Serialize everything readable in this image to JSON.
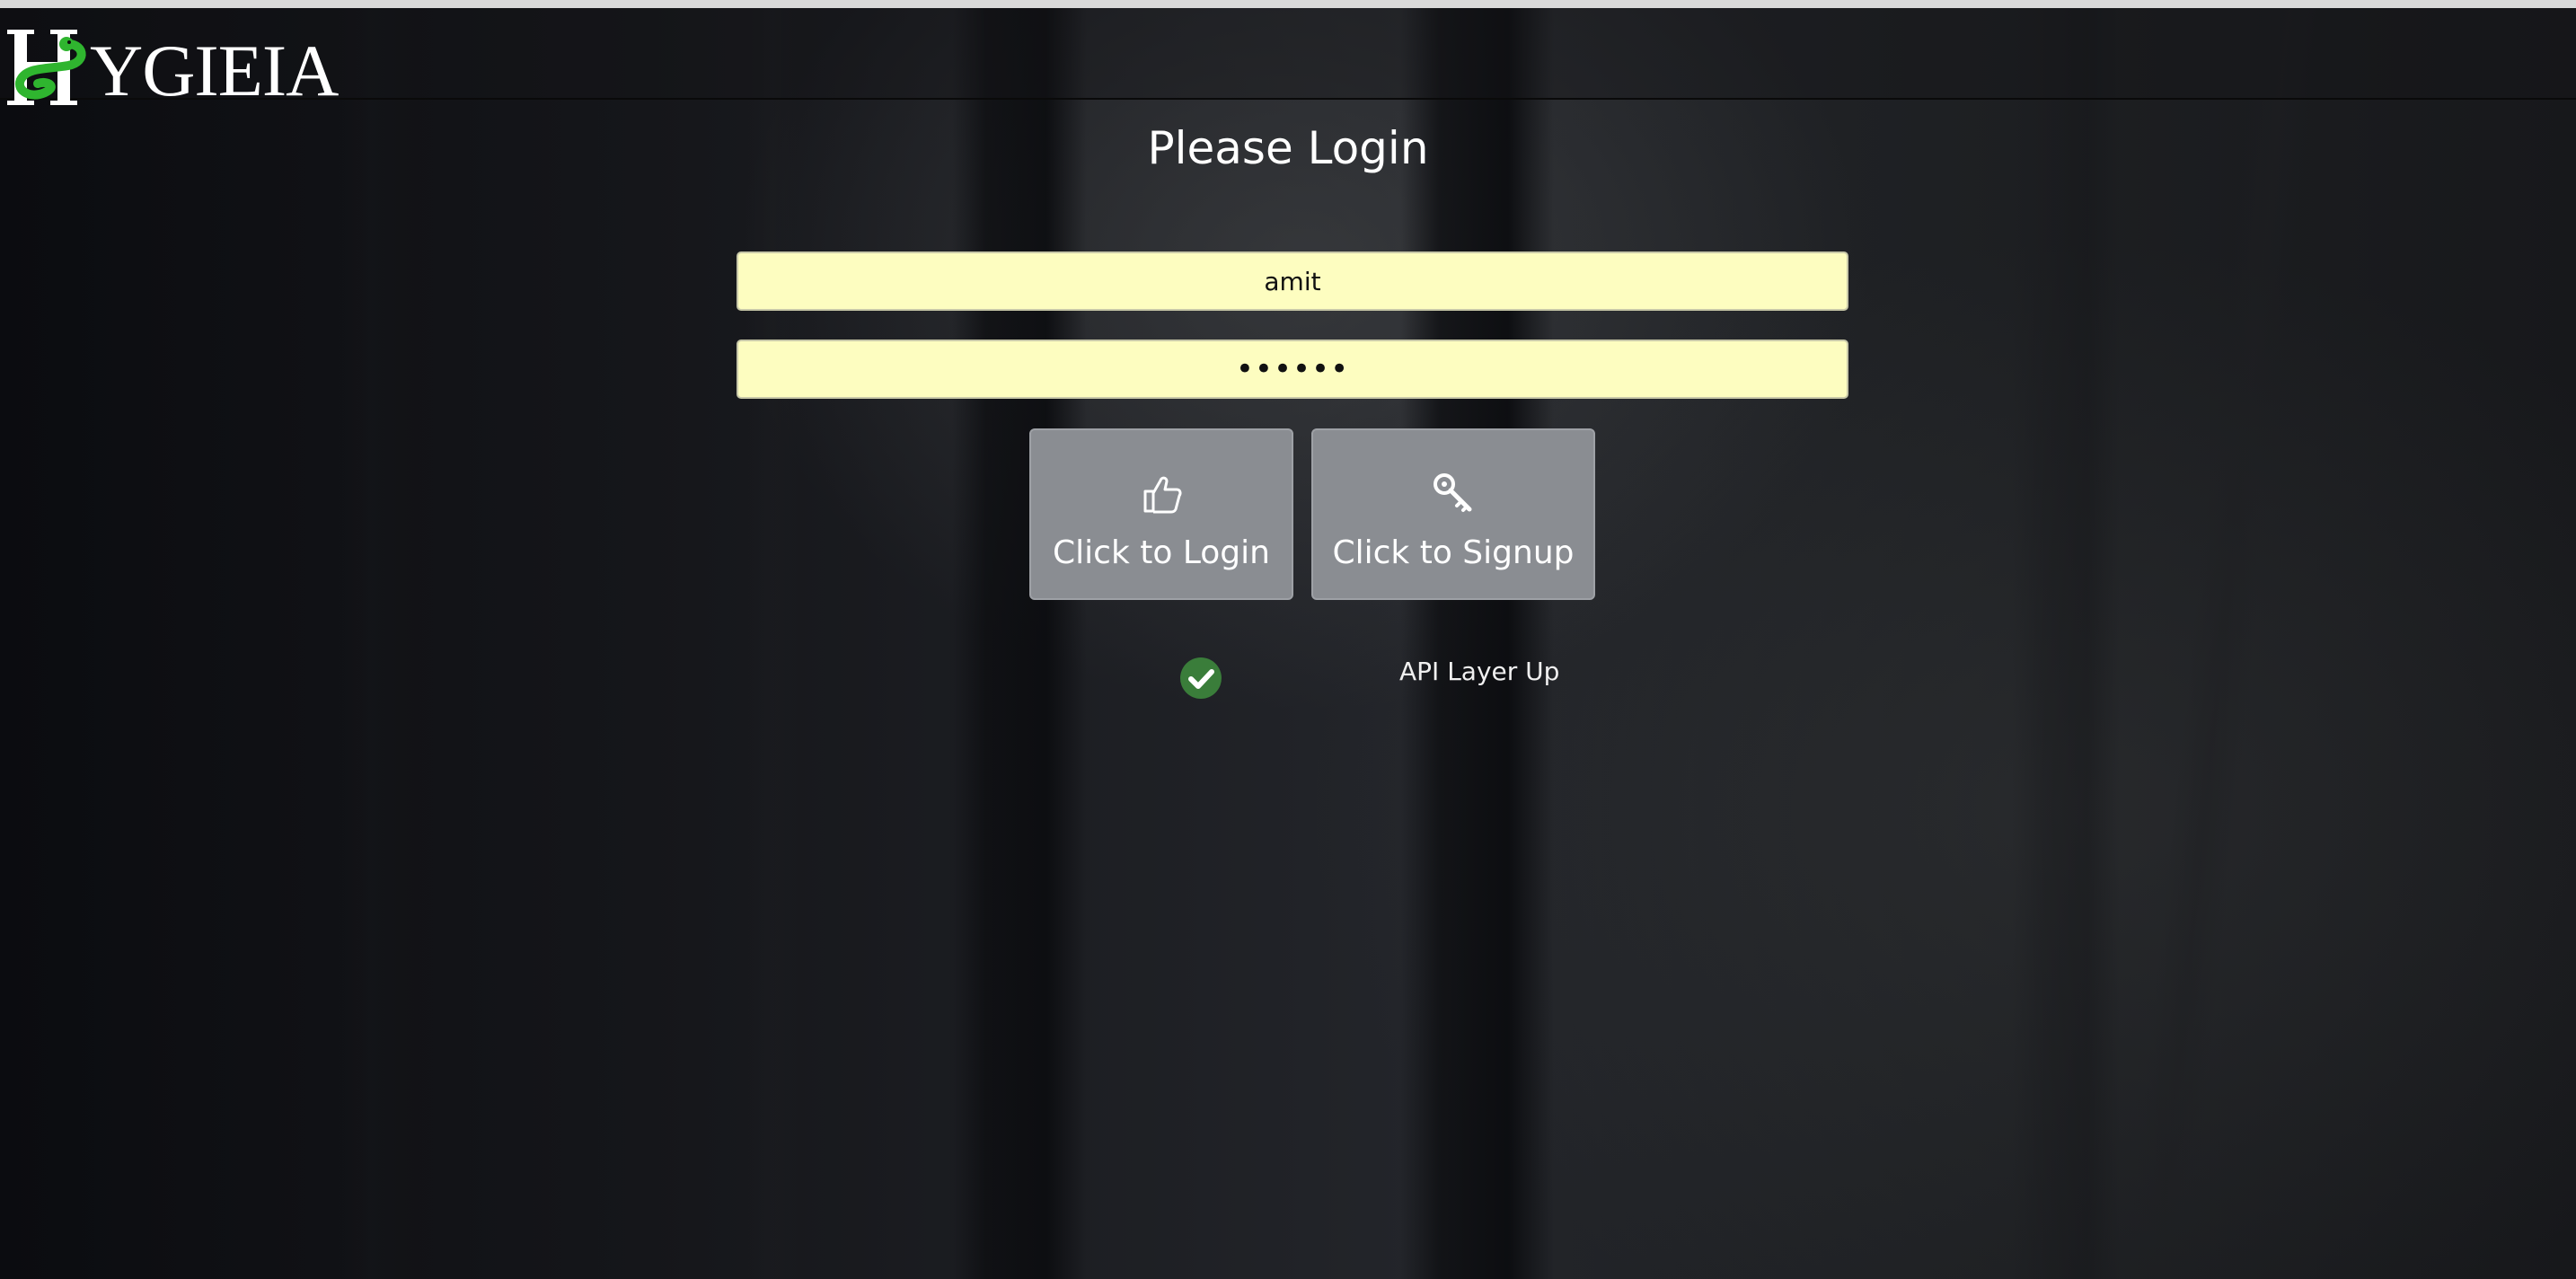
{
  "app": {
    "logo_text": "YGIEIA",
    "logo_initial": "H"
  },
  "login": {
    "title": "Please Login",
    "username_value": "amit",
    "password_value": "••••••",
    "login_button_label": "Click to Login",
    "signup_button_label": "Click to Signup"
  },
  "status": {
    "text": "API Layer Up",
    "icon": "check-circle-icon",
    "color": "#3a7d3a"
  },
  "icons": {
    "login": "thumbs-up-icon",
    "signup": "key-icon",
    "logo": "snake-icon"
  },
  "colors": {
    "input_background": "#fdfdc0",
    "button_background": "#8a8d92",
    "logo_green": "#2fb52f"
  }
}
